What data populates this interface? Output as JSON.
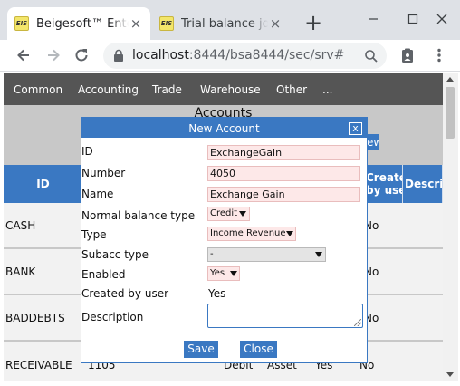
{
  "browser": {
    "tabs": [
      {
        "title": "Beigesoft™ Enterprise",
        "favicon_text": "EIS",
        "active": true
      },
      {
        "title": "Trial balance journal",
        "favicon_text": "EIS",
        "active": false
      }
    ],
    "url_host": "localhost",
    "url_rest": ":8444/bsa8444/sec/srv#",
    "icons": [
      "back-icon",
      "forward-icon",
      "reload-icon",
      "lock-icon",
      "search-icon",
      "clipboard-icon",
      "more-vert-icon",
      "minimize-icon",
      "maximize-icon",
      "close-icon",
      "new-tab-icon"
    ]
  },
  "menu": [
    "Common",
    "Accounting",
    "Trade",
    "Warehouse",
    "Other",
    "..."
  ],
  "page": {
    "title": "Accounts",
    "bg_button": "New",
    "columns": [
      "ID",
      "Created by user",
      "Description"
    ],
    "rows": [
      {
        "id": "CASH",
        "created": "No"
      },
      {
        "id": "BANK",
        "created": "No"
      },
      {
        "id": "BADDEBTS",
        "created": "No"
      },
      {
        "id": "RECEIVABLE",
        "number": "1105",
        "balance": "Debit",
        "type": "Asset",
        "enabled": "Yes",
        "created": "No"
      }
    ]
  },
  "dialog": {
    "title": "New Account",
    "close_label": "x",
    "fields": {
      "id": {
        "label": "ID",
        "value": "ExchangeGain"
      },
      "number": {
        "label": "Number",
        "value": "4050"
      },
      "name": {
        "label": "Name",
        "value": "Exchange Gain"
      },
      "normal_balance": {
        "label": "Normal balance type",
        "value": "Credit"
      },
      "type": {
        "label": "Type",
        "value": "Income Revenue"
      },
      "subacc": {
        "label": "Subacc type",
        "value": "-"
      },
      "enabled": {
        "label": "Enabled",
        "value": "Yes"
      },
      "created_by_user": {
        "label": "Created by user",
        "value": "Yes"
      },
      "description": {
        "label": "Description",
        "value": ""
      }
    },
    "save_label": "Save",
    "close_button_label": "Close"
  },
  "colors": {
    "accent": "#3a78c2",
    "menubar": "#555555",
    "required_field": "#fde8e8",
    "overlay": "#c8c8c8"
  }
}
